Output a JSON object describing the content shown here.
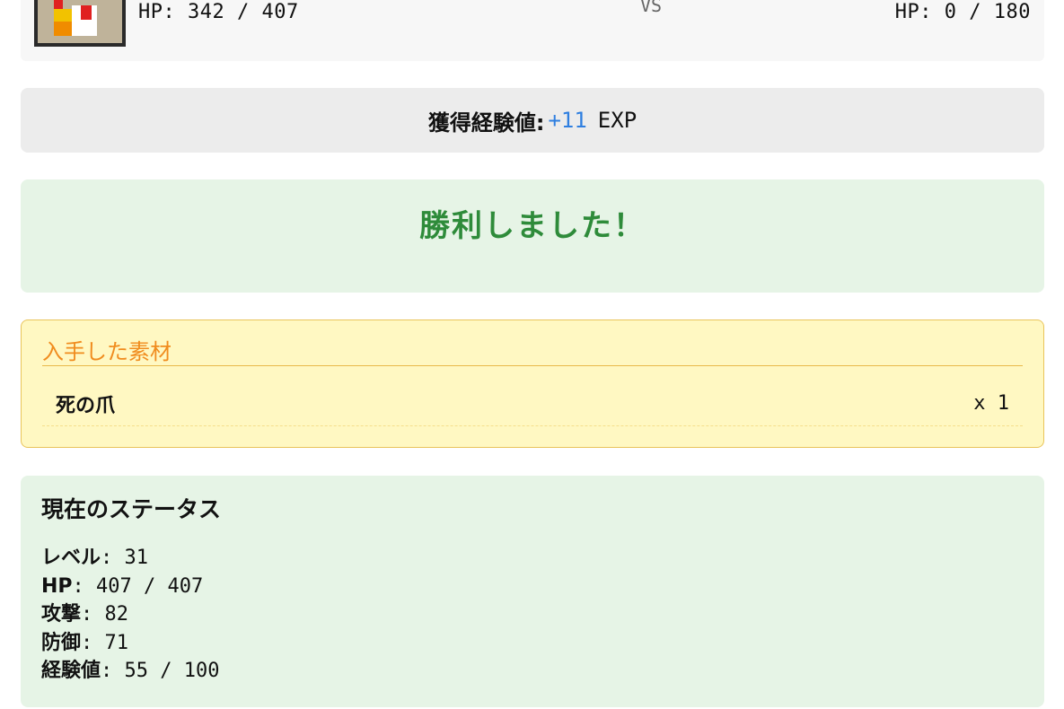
{
  "battle": {
    "player_hp_label": "HP: 342 / 407",
    "vs_label": "VS",
    "enemy_hp_label": "HP: 0 / 180"
  },
  "exp": {
    "label": "獲得経験値:",
    "value": "+11",
    "unit": "EXP"
  },
  "result": {
    "message": "勝利しました！"
  },
  "materials": {
    "title": "入手した素材",
    "items": [
      {
        "name": "死の爪",
        "quantity": "x 1"
      }
    ]
  },
  "status": {
    "title": "現在のステータス",
    "lines": [
      {
        "key": "レベル",
        "value": ": 31"
      },
      {
        "key": "HP",
        "value": ": 407 / 407"
      },
      {
        "key": "攻撃",
        "value": ": 82"
      },
      {
        "key": "防御",
        "value": ": 71"
      },
      {
        "key": "経験値",
        "value": ": 55 / 100"
      }
    ]
  },
  "colors": {
    "exp_value": "#2f7fe0",
    "victory": "#2e8b3a",
    "materials_title": "#f08c1e"
  },
  "icons": {
    "player_sprite": "pixel-character-sprite"
  }
}
